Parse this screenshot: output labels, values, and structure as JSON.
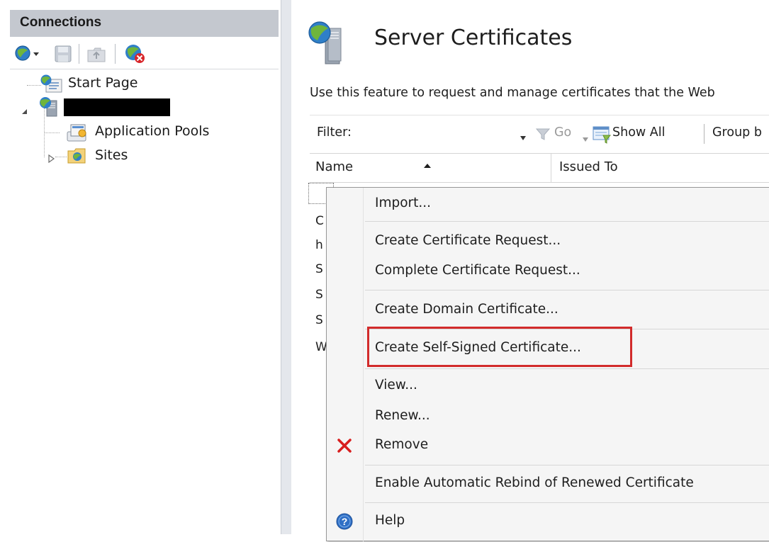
{
  "connections": {
    "title": "Connections",
    "toolbar": [
      "connect-icon",
      "save-icon",
      "up-level-icon",
      "disconnect-icon"
    ],
    "tree": {
      "start_page": "Start Page",
      "server": "",
      "application_pools": "Application Pools",
      "sites": "Sites"
    }
  },
  "main": {
    "title": "Server Certificates",
    "description": "Use this feature to request and manage certificates that the Web",
    "filter": {
      "label": "Filter:",
      "go": "Go",
      "show_all": "Show All",
      "group_by": "Group b"
    },
    "columns": [
      "Name",
      "Issued To"
    ],
    "row_stubs": [
      "C",
      "h",
      "S",
      "S",
      "S",
      "W"
    ]
  },
  "context_menu": {
    "items": [
      {
        "label": "Import...",
        "icon": ""
      },
      {
        "label": "Create Certificate Request...",
        "icon": ""
      },
      {
        "label": "Complete Certificate Request...",
        "icon": ""
      },
      {
        "label": "Create Domain Certificate...",
        "icon": ""
      },
      {
        "label": "Create Self-Signed Certificate...",
        "icon": ""
      },
      {
        "label": "View...",
        "icon": ""
      },
      {
        "label": "Renew...",
        "icon": ""
      },
      {
        "label": "Remove",
        "icon": "remove-x-icon"
      },
      {
        "label": "Enable Automatic Rebind of Renewed Certificate",
        "icon": ""
      },
      {
        "label": "Help",
        "icon": "help-icon"
      }
    ],
    "highlighted": "Create Self-Signed Certificate..."
  },
  "colors": {
    "highlight_border": "#d22b2b",
    "pane_header": "#c4c8cf",
    "remove_icon": "#d81e1e",
    "help_icon": "#2f6fc5"
  }
}
